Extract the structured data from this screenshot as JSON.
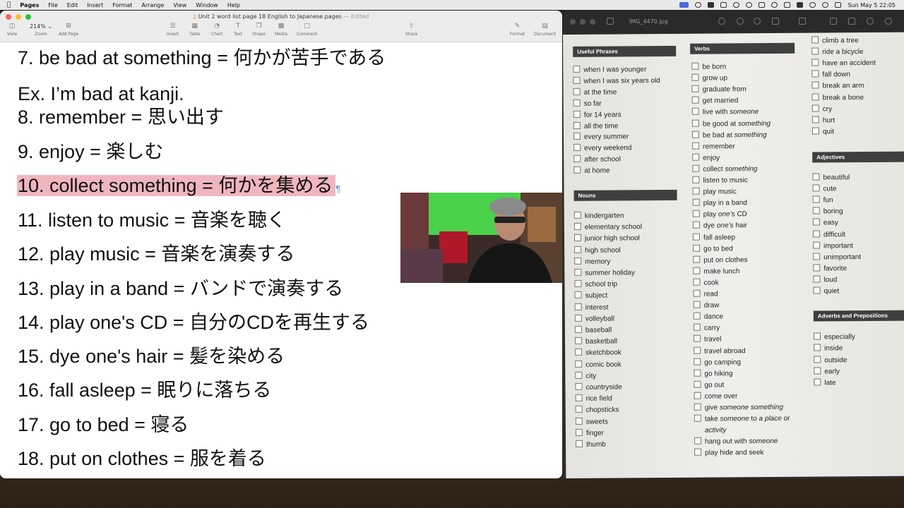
{
  "menubar": {
    "app": "Pages",
    "menus": [
      "File",
      "Edit",
      "Insert",
      "Format",
      "Arrange",
      "View",
      "Window",
      "Help"
    ],
    "clock": "Sun May 5  22:05"
  },
  "pages_window": {
    "title": "Unit 2 word list page 18 English to Japanese.pages",
    "edited": "Edited",
    "zoom": "214%",
    "toolbar": {
      "view": "View",
      "zoom": "Zoom",
      "add_page": "Add Page",
      "insert": "Insert",
      "table": "Table",
      "chart": "Chart",
      "text": "Text",
      "shape": "Shape",
      "media": "Media",
      "comment": "Comment",
      "share": "Share",
      "format": "Format",
      "document": "Document"
    },
    "lines": [
      "7. be bad at something = 何かが苦手である",
      "Ex. I’m bad at kanji.",
      "8. remember = 思い出す",
      "9. enjoy = 楽しむ",
      "10. collect something = 何かを集める",
      "11. listen to music = 音楽を聴く",
      "12. play music = 音楽を演奏する",
      "13. play in a band = バンドで演奏する",
      "14. play one's CD = 自分のCDを再生する",
      "15. dye one's hair = 髪を染める",
      "16. fall asleep = 眠りに落ちる",
      "17. go to bed = 寝る",
      "18. put on clothes = 服を着る"
    ],
    "highlight_index": 4,
    "pilcrow": "¶"
  },
  "preview_window": {
    "title": "IMG_4470.jpg",
    "useful_phrases": {
      "header": "Useful Phrases",
      "items": [
        "when I was younger",
        "when I was six years old",
        "at the time",
        "so far",
        "for 14 years",
        "all the time",
        "every summer",
        "every weekend",
        "after school",
        "at home"
      ]
    },
    "nouns": {
      "header": "Nouns",
      "items": [
        "kindergarten",
        "elementary school",
        "junior high school",
        "high school",
        "memory",
        "summer holiday",
        "school trip",
        "subject",
        "interest",
        "volleyball",
        "baseball",
        "basketball",
        "sketchbook",
        "comic book",
        "city",
        "countryside",
        "rice field",
        "chopsticks",
        "sweets",
        "finger",
        "thumb"
      ]
    },
    "verbs": {
      "header": "Verbs",
      "items": [
        {
          "t": "be born"
        },
        {
          "t": "grow up"
        },
        {
          "t": "graduate from"
        },
        {
          "t": "get married"
        },
        {
          "t": "live with ",
          "i": "someone"
        },
        {
          "t": "be good at ",
          "i": "something"
        },
        {
          "t": "be bad at ",
          "i": "something"
        },
        {
          "t": "remember"
        },
        {
          "t": "enjoy"
        },
        {
          "t": "collect ",
          "i": "something"
        },
        {
          "t": "listen to music"
        },
        {
          "t": "play music"
        },
        {
          "t": "play in a band"
        },
        {
          "t": "play ",
          "i": "one’s",
          "s": " CD"
        },
        {
          "t": "dye ",
          "i": "one’s",
          "s": " hair"
        },
        {
          "t": "fall asleep"
        },
        {
          "t": "go to bed"
        },
        {
          "t": "put on clothes"
        },
        {
          "t": "make lunch"
        },
        {
          "t": "cook"
        },
        {
          "t": "read"
        },
        {
          "t": "draw"
        },
        {
          "t": "dance"
        },
        {
          "t": "carry"
        },
        {
          "t": "travel"
        },
        {
          "t": "travel abroad"
        },
        {
          "t": "go camping"
        },
        {
          "t": "go hiking"
        },
        {
          "t": "go out"
        },
        {
          "t": "come over"
        },
        {
          "t": "give ",
          "i": "someone something"
        },
        {
          "t": "take ",
          "i": "someone",
          "s": " to ",
          "i2": "a place",
          "s2": " or"
        },
        {
          "t": "",
          "i": "activity"
        },
        {
          "t": "hang out with ",
          "i": "someone"
        },
        {
          "t": "play hide and seek"
        }
      ]
    },
    "col3_top": [
      "climb a tree",
      "ride a bicycle",
      "have an accident",
      "fall down",
      "break an arm",
      "break a bone",
      "cry",
      "hurt",
      "quit"
    ],
    "adjectives": {
      "header": "Adjectives",
      "items": [
        "beautiful",
        "cute",
        "fun",
        "boring",
        "easy",
        "difficult",
        "important",
        "unimportant",
        "favorite",
        "loud",
        "quiet"
      ]
    },
    "adverbs": {
      "header": "Adverbs and Prepositions",
      "items": [
        "especially",
        "inside",
        "outside",
        "early",
        "late"
      ]
    }
  }
}
